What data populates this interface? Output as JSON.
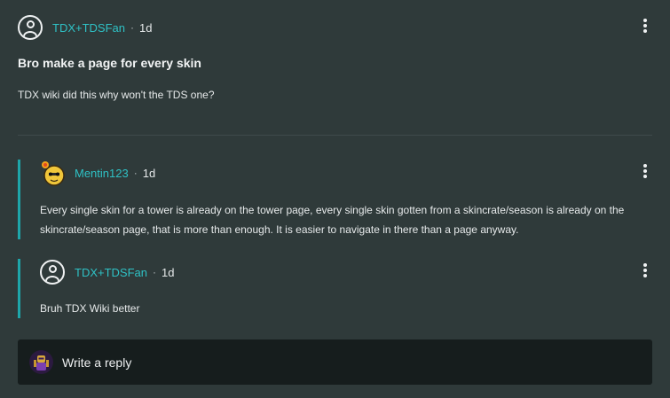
{
  "post": {
    "author": "TDX+TDSFan",
    "separator": "·",
    "time": "1d",
    "title": "Bro make a page for every skin",
    "body": "TDX wiki did this why won't the TDS one?"
  },
  "replies": [
    {
      "author": "Mentin123",
      "separator": "·",
      "time": "1d",
      "text": "Every single skin for a tower is already on the tower page, every single skin gotten from a skincrate/season is already on the skincrate/season page, that is more than enough. It is easier to navigate in there than a page anyway."
    },
    {
      "author": "TDX+TDSFan",
      "separator": "·",
      "time": "1d",
      "text": "Bruh TDX Wiki better"
    }
  ],
  "reply_box": {
    "placeholder": "Write a reply"
  },
  "colors": {
    "background": "#2f3a3a",
    "accent": "#2fc1c5",
    "thread_bar": "#1ea6aa",
    "input_bg": "#161d1d"
  },
  "icons": {
    "default_avatar": "user-circle-icon",
    "more": "kebab-menu-icon"
  }
}
